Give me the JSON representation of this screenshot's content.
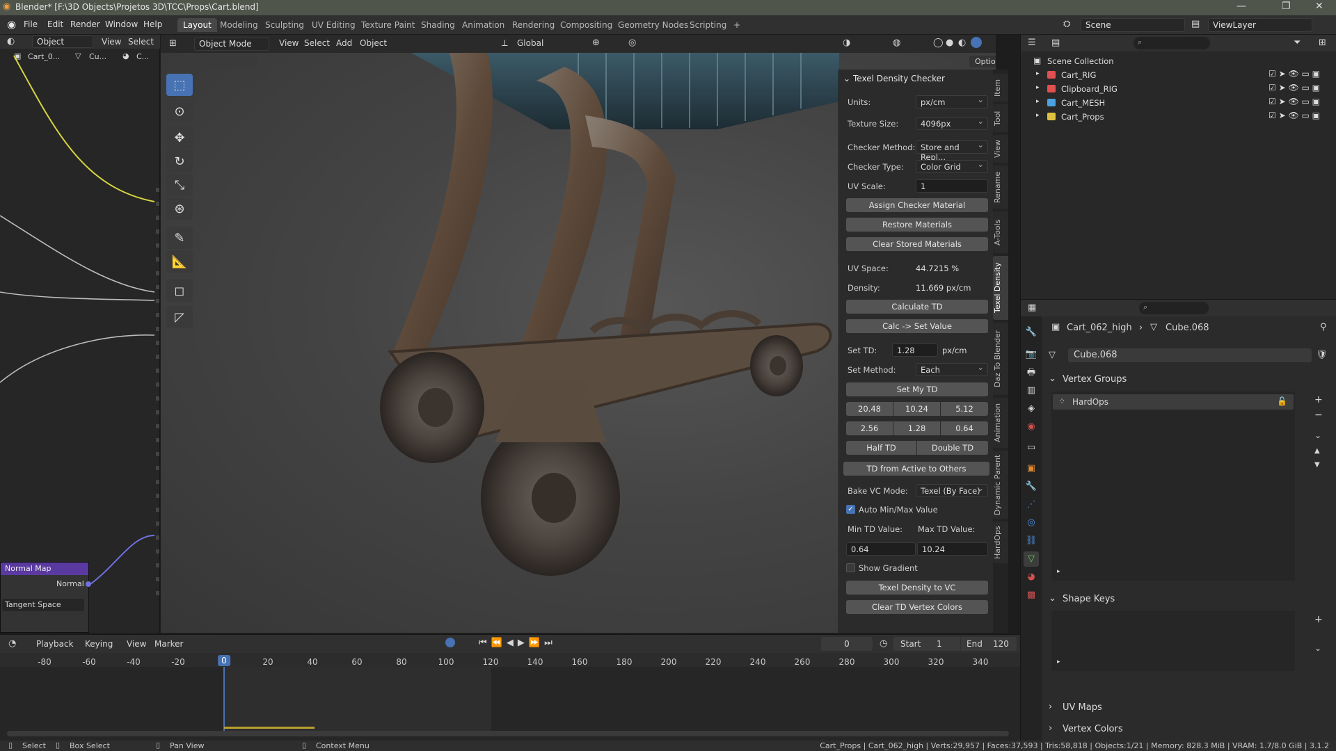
{
  "window": {
    "title": "Blender* [F:\\3D Objects\\Projetos 3D\\TCC\\Props\\Cart.blend]",
    "minimize": "—",
    "maximize": "❐",
    "close": "✕"
  },
  "menu": [
    "File",
    "Edit",
    "Render",
    "Window",
    "Help"
  ],
  "workspaces": [
    "Layout",
    "Modeling",
    "Sculpting",
    "UV Editing",
    "Texture Paint",
    "Shading",
    "Animation",
    "Rendering",
    "Compositing",
    "Geometry Nodes",
    "Scripting",
    "+"
  ],
  "scene": {
    "name": "Scene",
    "view_layer": "ViewLayer"
  },
  "node_editor": {
    "header": {
      "mode": "Object",
      "view": "View",
      "select": "Select"
    },
    "breadcrumb": [
      "Cart_0...",
      "Cu...",
      "C..."
    ],
    "normal_map_node": {
      "title": "Normal Map",
      "output": "Normal",
      "space": "Tangent Space"
    }
  },
  "viewport": {
    "mode": "Object Mode",
    "menus": [
      "View",
      "Select",
      "Add",
      "Object"
    ],
    "transform": "Global",
    "options": "Options"
  },
  "texel_panel": {
    "title": "Texel Density Checker",
    "units_label": "Units:",
    "units_value": "px/cm",
    "texture_size_label": "Texture Size:",
    "texture_size_value": "4096px",
    "checker_method_label": "Checker Method:",
    "checker_method_value": "Store and Repl...",
    "checker_type_label": "Checker Type:",
    "checker_type_value": "Color Grid",
    "uv_scale_label": "UV Scale:",
    "uv_scale_value": "1",
    "assign_checker": "Assign Checker Material",
    "restore_materials": "Restore Materials",
    "clear_stored": "Clear Stored Materials",
    "uv_space_label": "UV Space:",
    "uv_space_value": "44.7215 %",
    "density_label": "Density:",
    "density_value": "11.669 px/cm",
    "calculate_td": "Calculate TD",
    "calc_set_value": "Calc -> Set Value",
    "set_td_label": "Set TD:",
    "set_td_value": "1.28",
    "set_td_unit": "px/cm",
    "set_method_label": "Set Method:",
    "set_method_value": "Each",
    "set_my_td": "Set My TD",
    "presets": [
      "20.48",
      "10.24",
      "5.12",
      "2.56",
      "1.28",
      "0.64"
    ],
    "half_td": "Half TD",
    "double_td": "Double TD",
    "td_active_others": "TD from Active to Others",
    "bake_vc_label": "Bake VC Mode:",
    "bake_vc_value": "Texel (By Face)",
    "auto_minmax": "Auto Min/Max Value",
    "min_td_label": "Min TD Value:",
    "max_td_label": "Max TD Value:",
    "min_td_value": "0.64",
    "max_td_value": "10.24",
    "show_gradient": "Show Gradient",
    "td_to_vc": "Texel Density to VC",
    "clear_td_vc": "Clear TD Vertex Colors"
  },
  "side_tabs": [
    "Item",
    "Tool",
    "View",
    "Rename",
    "A-Tools",
    "Texel Density",
    "Daz To Blender",
    "Animation",
    "Dynamic Parent",
    "HardOps"
  ],
  "outliner": {
    "root": "Scene Collection",
    "items": [
      {
        "name": "Cart_RIG",
        "color": "#e05050"
      },
      {
        "name": "Clipboard_RIG",
        "color": "#e05050"
      },
      {
        "name": "Cart_MESH",
        "color": "#4aa3e0"
      },
      {
        "name": "Cart_Props",
        "color": "#e0c040"
      }
    ]
  },
  "properties": {
    "object": "Cart_062_high",
    "mesh": "Cube.068",
    "mesh_field": "Cube.068",
    "vertex_groups": "Vertex Groups",
    "vg_item": "HardOps",
    "shape_keys": "Shape Keys",
    "uv_maps": "UV Maps",
    "vertex_colors": "Vertex Colors"
  },
  "timeline": {
    "menus": [
      "Playback",
      "Keying",
      "View",
      "Marker"
    ],
    "current_frame": "0",
    "start_label": "Start",
    "start": "1",
    "end_label": "End",
    "end": "120",
    "ticks": [
      "-80",
      "-60",
      "-40",
      "-20",
      "0",
      "20",
      "40",
      "60",
      "80",
      "100",
      "120",
      "140",
      "160",
      "180",
      "200",
      "220",
      "240",
      "260",
      "280",
      "300",
      "320",
      "340"
    ]
  },
  "status": {
    "select": "Select",
    "box_select": "Box Select",
    "pan_view": "Pan View",
    "context_menu": "Context Menu",
    "stats": "Cart_Props | Cart_062_high | Verts:29,957 | Faces:37,593 | Tris:58,818 | Objects:1/21 | Memory: 828.3 MiB | VRAM: 1.7/8.0 GiB | 3.1.2"
  }
}
